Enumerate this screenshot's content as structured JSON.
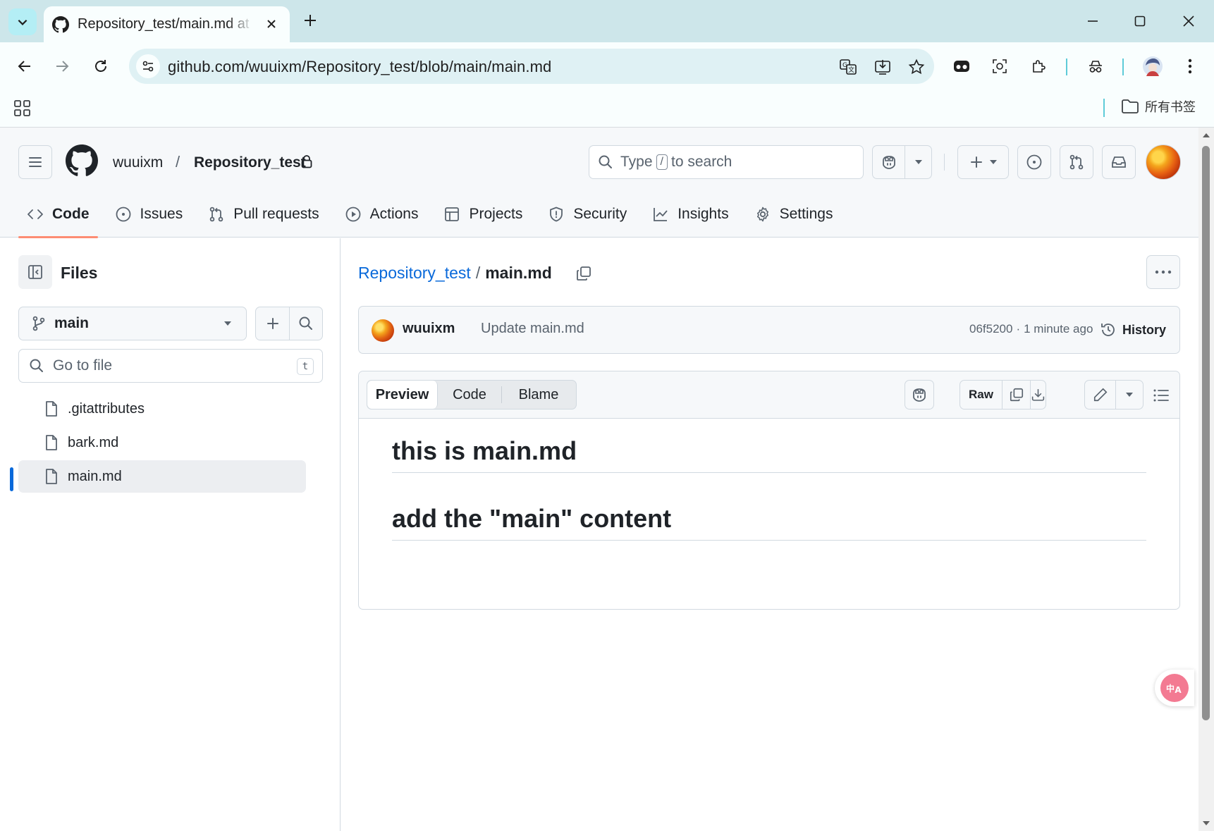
{
  "browser": {
    "tab_title": "Repository_test/main.md at main",
    "url": "github.com/wuuixm/Repository_test/blob/main/main.md",
    "bookmarks_folder_label": "所有书签"
  },
  "header": {
    "owner": "wuuixm",
    "separator": "/",
    "repo": "Repository_test",
    "search_prefix": "Type",
    "search_key": "/",
    "search_suffix": "to search"
  },
  "repo_nav": [
    {
      "label": "Code",
      "icon": "code-icon",
      "selected": true
    },
    {
      "label": "Issues",
      "icon": "issue-opened-icon"
    },
    {
      "label": "Pull requests",
      "icon": "git-pull-request-icon"
    },
    {
      "label": "Actions",
      "icon": "play-icon"
    },
    {
      "label": "Projects",
      "icon": "table-icon"
    },
    {
      "label": "Security",
      "icon": "shield-icon"
    },
    {
      "label": "Insights",
      "icon": "graph-icon"
    },
    {
      "label": "Settings",
      "icon": "gear-icon"
    }
  ],
  "sidebar": {
    "title": "Files",
    "branch": "main",
    "go_to_file_placeholder": "Go to file",
    "go_to_file_shortcut": "t",
    "files": [
      {
        "name": ".gitattributes",
        "selected": false
      },
      {
        "name": "bark.md",
        "selected": false
      },
      {
        "name": "main.md",
        "selected": true
      }
    ]
  },
  "main": {
    "breadcrumb_repo": "Repository_test",
    "breadcrumb_sep": "/",
    "breadcrumb_file": "main.md",
    "commit": {
      "author": "wuuixm",
      "message": "Update main.md",
      "sha": "06f5200",
      "dot": "·",
      "time": "1 minute ago",
      "history_label": "History"
    },
    "view_tabs": [
      "Preview",
      "Code",
      "Blame"
    ],
    "raw_label": "Raw",
    "content": [
      "this is main.md",
      "add the \"main\" content"
    ]
  },
  "colors": {
    "accent_blue": "#0969da",
    "nav_underline": "#fd8c73",
    "chrome_tabbar": "#cde6ea",
    "translate_fab": "#f37a92"
  }
}
